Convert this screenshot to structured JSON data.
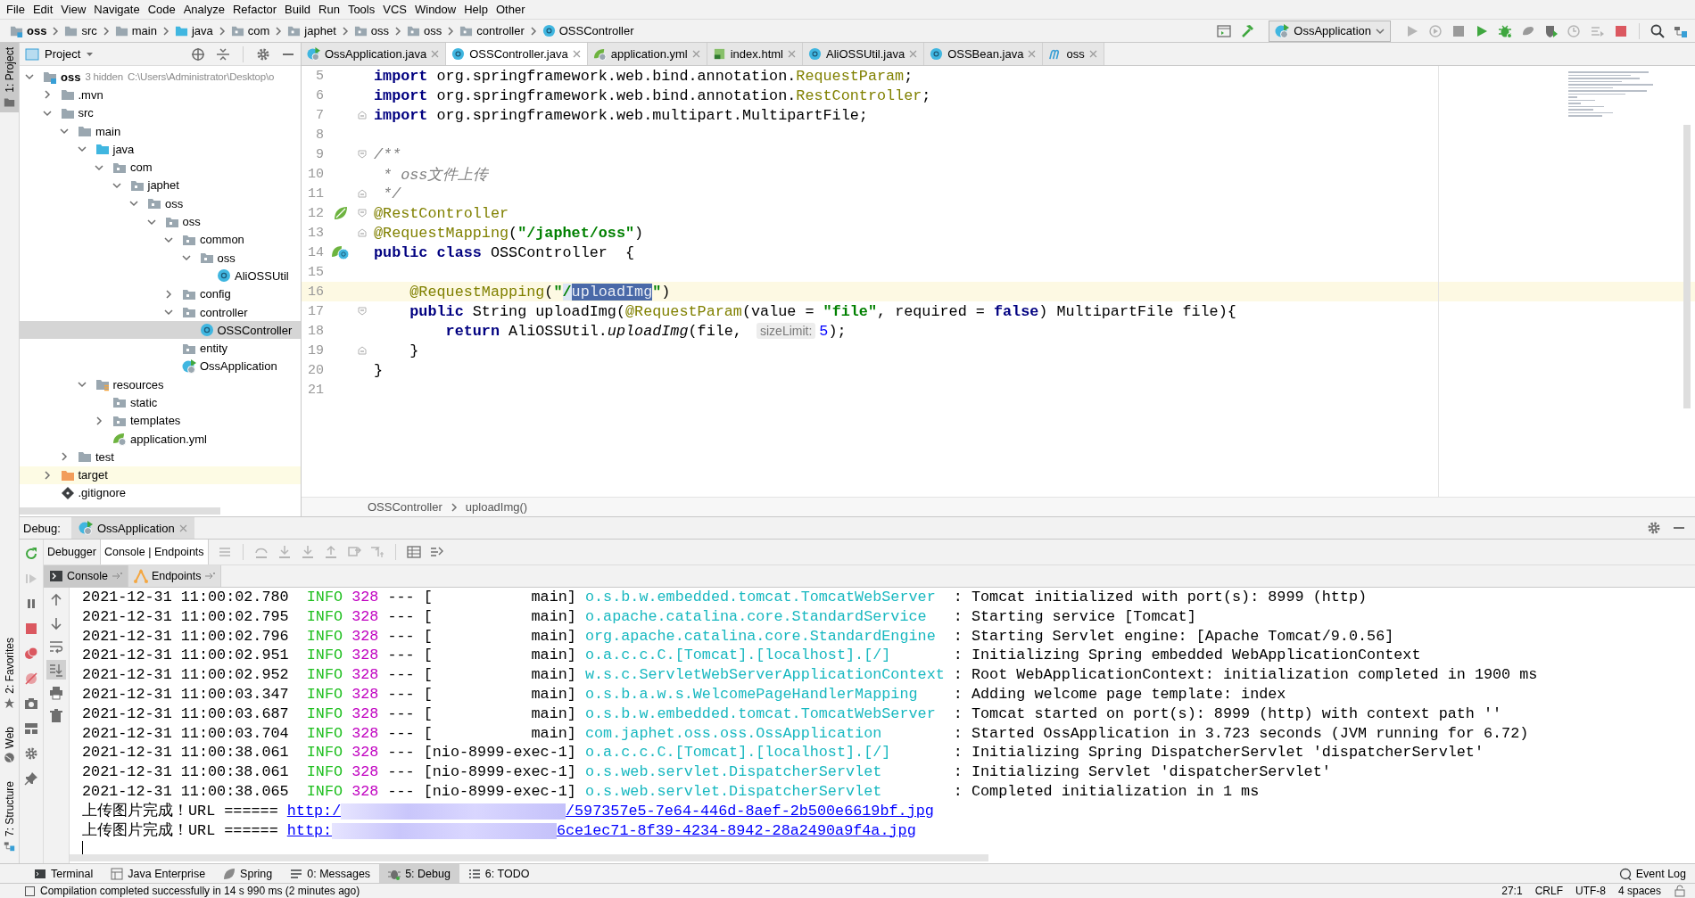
{
  "menu": [
    "File",
    "Edit",
    "View",
    "Navigate",
    "Code",
    "Analyze",
    "Refactor",
    "Build",
    "Run",
    "Tools",
    "VCS",
    "Window",
    "Help",
    "Other"
  ],
  "breadcrumbs": [
    {
      "label": "oss",
      "kind": "module"
    },
    {
      "label": "src",
      "kind": "folder"
    },
    {
      "label": "main",
      "kind": "folder"
    },
    {
      "label": "java",
      "kind": "source"
    },
    {
      "label": "com",
      "kind": "package"
    },
    {
      "label": "japhet",
      "kind": "package"
    },
    {
      "label": "oss",
      "kind": "package"
    },
    {
      "label": "oss",
      "kind": "package"
    },
    {
      "label": "controller",
      "kind": "package"
    },
    {
      "label": "OSSController",
      "kind": "class"
    }
  ],
  "run_config": {
    "label": "OssApplication"
  },
  "left_stripe": [
    {
      "label": "1: Project",
      "kind": "project",
      "selected": true
    },
    {
      "label": "2: Favorites",
      "kind": "favorites",
      "selected": false
    },
    {
      "label": "Web",
      "kind": "web",
      "selected": false
    },
    {
      "label": "7: Structure",
      "kind": "structure",
      "selected": false
    }
  ],
  "project": {
    "title": "Project",
    "tree": [
      {
        "label": "oss",
        "kind": "module",
        "expanded": true,
        "selected": false,
        "note": "3 hidden",
        "path": "C:\\Users\\Administrator\\Desktop\\o",
        "children": [
          {
            "label": ".mvn",
            "kind": "folder",
            "expanded": false,
            "selected": false
          },
          {
            "label": "src",
            "kind": "folder",
            "expanded": true,
            "selected": false,
            "children": [
              {
                "label": "main",
                "kind": "folder",
                "expanded": true,
                "selected": false,
                "children": [
                  {
                    "label": "java",
                    "kind": "source",
                    "expanded": true,
                    "selected": false,
                    "children": [
                      {
                        "label": "com",
                        "kind": "package",
                        "expanded": true,
                        "selected": false,
                        "children": [
                          {
                            "label": "japhet",
                            "kind": "package",
                            "expanded": true,
                            "selected": false,
                            "children": [
                              {
                                "label": "oss",
                                "kind": "package",
                                "expanded": true,
                                "selected": false,
                                "children": [
                                  {
                                    "label": "oss",
                                    "kind": "package",
                                    "expanded": true,
                                    "selected": false,
                                    "children": [
                                      {
                                        "label": "common",
                                        "kind": "package",
                                        "expanded": true,
                                        "selected": false,
                                        "children": [
                                          {
                                            "label": "oss",
                                            "kind": "package",
                                            "expanded": true,
                                            "selected": false,
                                            "children": [
                                              {
                                                "label": "AliOSSUtil",
                                                "kind": "class",
                                                "selected": false
                                              }
                                            ]
                                          }
                                        ]
                                      },
                                      {
                                        "label": "config",
                                        "kind": "package",
                                        "expanded": false,
                                        "selected": false
                                      },
                                      {
                                        "label": "controller",
                                        "kind": "package",
                                        "expanded": true,
                                        "selected": false,
                                        "children": [
                                          {
                                            "label": "OSSController",
                                            "kind": "class",
                                            "selected": true
                                          }
                                        ]
                                      },
                                      {
                                        "label": "entity",
                                        "kind": "package",
                                        "selected": false
                                      },
                                      {
                                        "label": "OssApplication",
                                        "kind": "springapp",
                                        "selected": false
                                      }
                                    ]
                                  }
                                ]
                              }
                            ]
                          }
                        ]
                      }
                    ]
                  },
                  {
                    "label": "resources",
                    "kind": "resources",
                    "expanded": true,
                    "selected": false,
                    "children": [
                      {
                        "label": "static",
                        "kind": "package",
                        "selected": false
                      },
                      {
                        "label": "templates",
                        "kind": "package",
                        "expanded": false,
                        "selected": false
                      },
                      {
                        "label": "application.yml",
                        "kind": "yml",
                        "selected": false
                      }
                    ]
                  }
                ]
              },
              {
                "label": "test",
                "kind": "folder",
                "expanded": false,
                "selected": false
              }
            ]
          },
          {
            "label": "target",
            "kind": "excluded",
            "expanded": false,
            "selected": false
          },
          {
            "label": ".gitignore",
            "kind": "git",
            "selected": false
          }
        ]
      }
    ]
  },
  "editor": {
    "tabs": [
      {
        "label": "OssApplication.java",
        "kind": "springapp",
        "selected": false
      },
      {
        "label": "OSSController.java",
        "kind": "class",
        "selected": true
      },
      {
        "label": "application.yml",
        "kind": "yml",
        "selected": false
      },
      {
        "label": "index.html",
        "kind": "html",
        "selected": false
      },
      {
        "label": "AliOSSUtil.java",
        "kind": "class",
        "selected": false
      },
      {
        "label": "OSSBean.java",
        "kind": "class",
        "selected": false
      },
      {
        "label": "oss",
        "kind": "maven",
        "selected": false
      }
    ],
    "lines": [
      {
        "number": "5",
        "current": false,
        "tokens": [
          {
            "kind": "kw",
            "text": "import"
          },
          {
            "kind": "plain",
            "text": " org.springframework.web.bind.annotation."
          },
          {
            "kind": "ann",
            "text": "RequestParam"
          },
          {
            "kind": "plain",
            "text": ";"
          }
        ]
      },
      {
        "number": "6",
        "current": false,
        "tokens": [
          {
            "kind": "kw",
            "text": "import"
          },
          {
            "kind": "plain",
            "text": " org.springframework.web.bind.annotation."
          },
          {
            "kind": "ann",
            "text": "RestController"
          },
          {
            "kind": "plain",
            "text": ";"
          }
        ]
      },
      {
        "number": "7",
        "current": false,
        "fold_end": true,
        "tokens": [
          {
            "kind": "kw",
            "text": "import"
          },
          {
            "kind": "plain",
            "text": " org.springframework.web.multipart.MultipartFile;"
          }
        ]
      },
      {
        "number": "8",
        "current": false
      },
      {
        "number": "9",
        "current": false,
        "fold_start": true,
        "tokens": [
          {
            "kind": "comment",
            "text": "/**"
          }
        ]
      },
      {
        "number": "10",
        "current": false,
        "tokens": [
          {
            "kind": "comment",
            "text": " * oss文件上传"
          }
        ]
      },
      {
        "number": "11",
        "current": false,
        "fold_end": true,
        "tokens": [
          {
            "kind": "comment",
            "text": " */"
          }
        ]
      },
      {
        "number": "12",
        "current": false,
        "bean_marker": true,
        "fold_start": true,
        "tokens": [
          {
            "kind": "ann",
            "text": "@RestController"
          }
        ]
      },
      {
        "number": "13",
        "current": false,
        "fold_end": true,
        "tokens": [
          {
            "kind": "ann",
            "text": "@RequestMapping"
          },
          {
            "kind": "plain",
            "text": "("
          },
          {
            "kind": "str",
            "text": "\"/japhet/oss\""
          },
          {
            "kind": "plain",
            "text": ")"
          }
        ]
      },
      {
        "number": "14",
        "current": false,
        "class_bean_marker": true,
        "tokens": [
          {
            "kind": "kw",
            "text": "public class"
          },
          {
            "kind": "plain",
            "text": " OSSController  {"
          }
        ]
      },
      {
        "number": "15",
        "current": false
      },
      {
        "number": "16",
        "current": true,
        "tokens": [
          {
            "kind": "ann",
            "text": "    @RequestMapping"
          },
          {
            "kind": "plain",
            "text": "("
          },
          {
            "kind": "str",
            "text": "\""
          },
          {
            "kind": "usage",
            "text": "/"
          },
          {
            "kind": "selection",
            "text": "uploadImg"
          },
          {
            "kind": "str",
            "text": "\""
          },
          {
            "kind": "plain",
            "text": ")"
          }
        ]
      },
      {
        "number": "17",
        "current": false,
        "fold_start": true,
        "tokens": [
          {
            "kind": "kw",
            "text": "    public"
          },
          {
            "kind": "plain",
            "text": " String uploadImg("
          },
          {
            "kind": "ann",
            "text": "@RequestParam"
          },
          {
            "kind": "plain",
            "text": "(value = "
          },
          {
            "kind": "str",
            "text": "\"file\""
          },
          {
            "kind": "plain",
            "text": ", required = "
          },
          {
            "kind": "kw",
            "text": "false"
          },
          {
            "kind": "plain",
            "text": ") MultipartFile file){"
          }
        ]
      },
      {
        "number": "18",
        "current": false,
        "tokens": [
          {
            "kind": "kw",
            "text": "        return"
          },
          {
            "kind": "plain",
            "text": " AliOSSUtil."
          },
          {
            "kind": "italic",
            "text": "uploadImg"
          },
          {
            "kind": "plain",
            "text": "(file, "
          },
          {
            "kind": "hint",
            "text": "sizeLimit:"
          },
          {
            "kind": "num",
            "text": "5"
          },
          {
            "kind": "plain",
            "text": ");"
          }
        ]
      },
      {
        "number": "19",
        "current": false,
        "fold_end": true,
        "tokens": [
          {
            "kind": "plain",
            "text": "    }"
          }
        ]
      },
      {
        "number": "20",
        "current": false,
        "tokens": [
          {
            "kind": "plain",
            "text": "}"
          }
        ]
      },
      {
        "number": "21",
        "current": false
      }
    ],
    "breadcrumbs": [
      "OSSController",
      "uploadImg()"
    ]
  },
  "debug": {
    "label": "Debug:",
    "session": "OssApplication",
    "view_tabs": [
      {
        "label": "Debugger",
        "selected": false
      },
      {
        "label": "Console | Endpoints",
        "selected": true
      }
    ],
    "console_tabs": [
      {
        "label": "Console",
        "kind": "console",
        "selected": true
      },
      {
        "label": "Endpoints",
        "kind": "endpoints",
        "selected": false
      }
    ],
    "log": [
      {
        "date": "2021-12-31 11:00:02.780",
        "level": "INFO",
        "pid": "328",
        "sep": "---",
        "thread": "[           main]",
        "logger": "o.s.b.w.embedded.tomcat.TomcatWebServer",
        "message": ": Tomcat initialized with port(s): 8999 (http)"
      },
      {
        "date": "2021-12-31 11:00:02.795",
        "level": "INFO",
        "pid": "328",
        "sep": "---",
        "thread": "[           main]",
        "logger": "o.apache.catalina.core.StandardService",
        "message": ": Starting service [Tomcat]"
      },
      {
        "date": "2021-12-31 11:00:02.796",
        "level": "INFO",
        "pid": "328",
        "sep": "---",
        "thread": "[           main]",
        "logger": "org.apache.catalina.core.StandardEngine",
        "message": ": Starting Servlet engine: [Apache Tomcat/9.0.56]"
      },
      {
        "date": "2021-12-31 11:00:02.951",
        "level": "INFO",
        "pid": "328",
        "sep": "---",
        "thread": "[           main]",
        "logger": "o.a.c.c.C.[Tomcat].[localhost].[/]",
        "message": ": Initializing Spring embedded WebApplicationContext"
      },
      {
        "date": "2021-12-31 11:00:02.952",
        "level": "INFO",
        "pid": "328",
        "sep": "---",
        "thread": "[           main]",
        "logger": "w.s.c.ServletWebServerApplicationContext",
        "message": ": Root WebApplicationContext: initialization completed in 1900 ms"
      },
      {
        "date": "2021-12-31 11:00:03.347",
        "level": "INFO",
        "pid": "328",
        "sep": "---",
        "thread": "[           main]",
        "logger": "o.s.b.a.w.s.WelcomePageHandlerMapping",
        "message": ": Adding welcome page template: index"
      },
      {
        "date": "2021-12-31 11:00:03.687",
        "level": "INFO",
        "pid": "328",
        "sep": "---",
        "thread": "[           main]",
        "logger": "o.s.b.w.embedded.tomcat.TomcatWebServer",
        "message": ": Tomcat started on port(s): 8999 (http) with context path ''"
      },
      {
        "date": "2021-12-31 11:00:03.704",
        "level": "INFO",
        "pid": "328",
        "sep": "---",
        "thread": "[           main]",
        "logger": "com.japhet.oss.oss.OssApplication",
        "message": ": Started OssApplication in 3.723 seconds (JVM running for 6.72)"
      },
      {
        "date": "2021-12-31 11:00:38.061",
        "level": "INFO",
        "pid": "328",
        "sep": "---",
        "thread": "[nio-8999-exec-1]",
        "logger": "o.a.c.c.C.[Tomcat].[localhost].[/]",
        "message": ": Initializing Spring DispatcherServlet 'dispatcherServlet'"
      },
      {
        "date": "2021-12-31 11:00:38.061",
        "level": "INFO",
        "pid": "328",
        "sep": "---",
        "thread": "[nio-8999-exec-1]",
        "logger": "o.s.web.servlet.DispatcherServlet",
        "message": ": Initializing Servlet 'dispatcherServlet'"
      },
      {
        "date": "2021-12-31 11:00:38.065",
        "level": "INFO",
        "pid": "328",
        "sep": "---",
        "thread": "[nio-8999-exec-1]",
        "logger": "o.s.web.servlet.DispatcherServlet",
        "message": ": Completed initialization in 1 ms"
      }
    ],
    "uploads": [
      {
        "prefix": "上传图片完成！URL ======",
        "url_start": "http:/",
        "url_end": "/597357e5-7e64-446d-8aef-2b500e6619bf.jpg"
      },
      {
        "prefix": "上传图片完成！URL ======",
        "url_start": "http:",
        "url_end": "6ce1ec71-8f39-4234-8942-28a2490a9f4a.jpg"
      }
    ]
  },
  "bottom_tools": [
    {
      "label": "Terminal",
      "kind": "terminal",
      "selected": false
    },
    {
      "label": "Java Enterprise",
      "kind": "enterprise",
      "selected": false
    },
    {
      "label": "Spring",
      "kind": "spring",
      "selected": false
    },
    {
      "label": "0: Messages",
      "kind": "messages",
      "selected": false
    },
    {
      "label": "5: Debug",
      "kind": "debug",
      "selected": true
    },
    {
      "label": "6: TODO",
      "kind": "todo",
      "selected": false
    }
  ],
  "event_log": "Event Log",
  "status_bar": {
    "message": "Compilation completed successfully in 14 s 990 ms (2 minutes ago)",
    "position": "27:1",
    "line_separator": "CRLF",
    "encoding": "UTF-8",
    "indent": "4 spaces"
  }
}
